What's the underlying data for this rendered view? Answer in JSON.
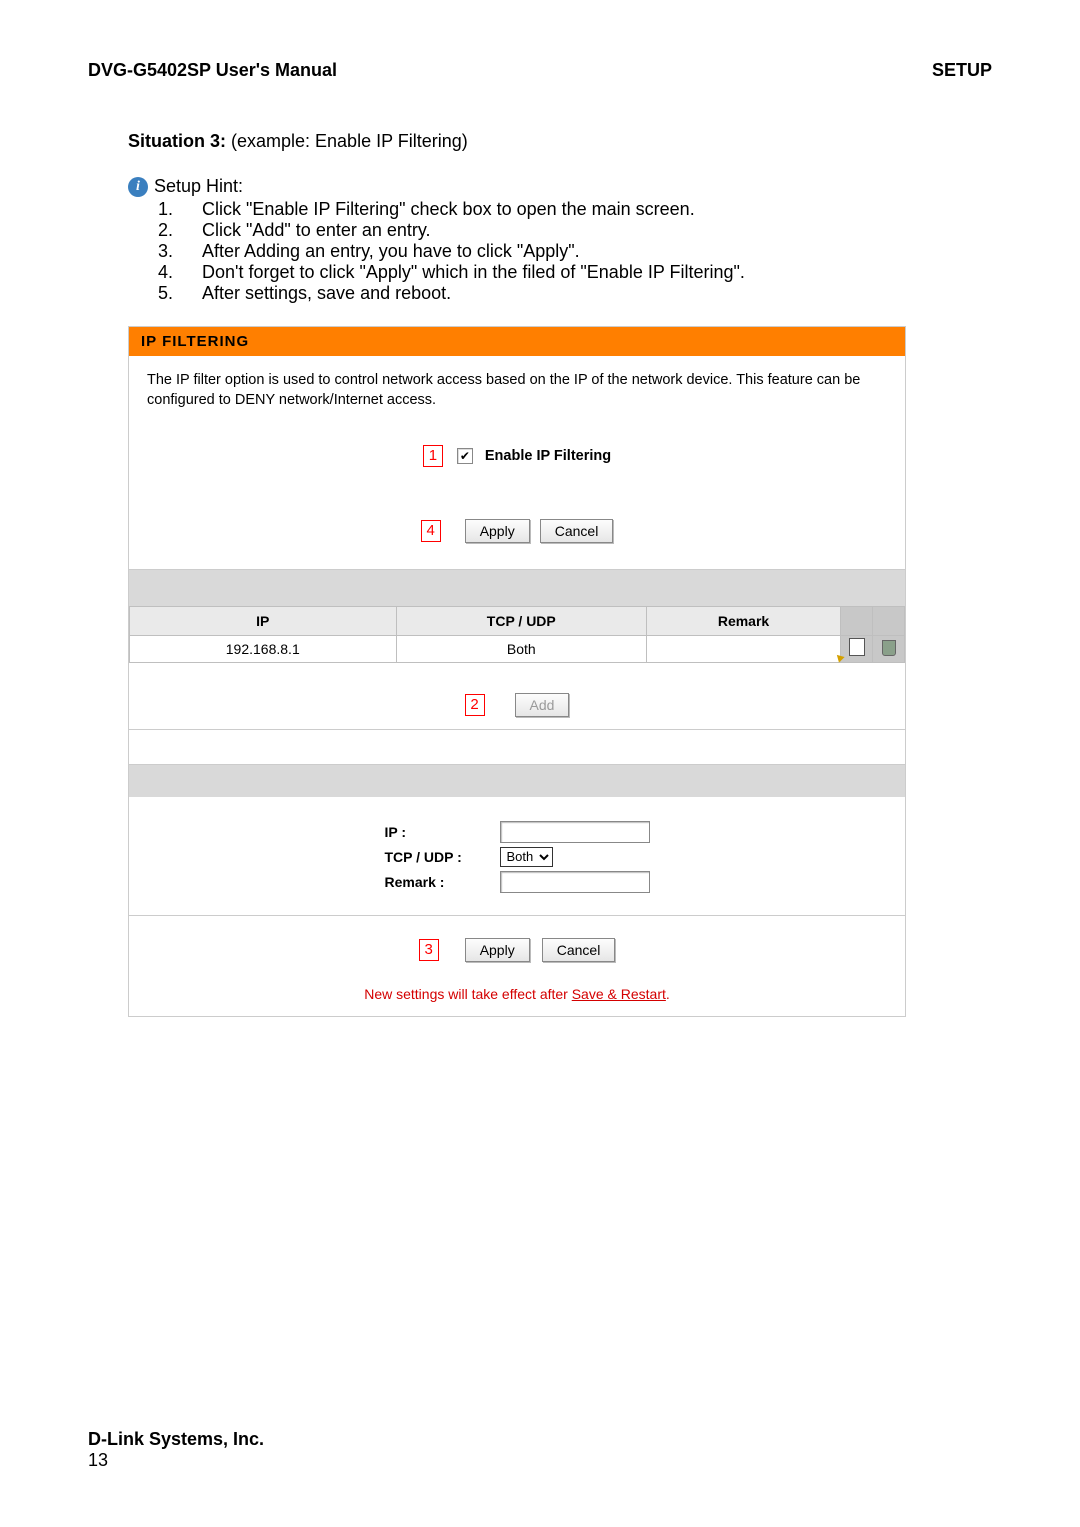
{
  "header": {
    "left": "DVG-G5402SP User's Manual",
    "right": "SETUP"
  },
  "situation": {
    "prefix": "Situation 3:",
    "text": " (example: Enable IP Filtering)"
  },
  "hint": {
    "title": "Setup Hint:",
    "items": [
      "Click \"Enable IP Filtering\" check box to open the main screen.",
      "Click \"Add\" to enter an entry.",
      "After Adding an entry, you have to click \"Apply\".",
      "Don't forget to click \"Apply\" which in the filed of \"Enable IP Filtering\".",
      "After settings, save and reboot."
    ]
  },
  "panel": {
    "title": "IP FILTERING",
    "desc": "The IP filter option is used to control network access based on the IP of the network device. This feature can be configured to DENY network/Internet access."
  },
  "callouts": {
    "c1": "1",
    "c2": "2",
    "c3": "3",
    "c4": "4"
  },
  "enable": {
    "label": "Enable IP Filtering",
    "checked": true
  },
  "buttons": {
    "apply": "Apply",
    "cancel": "Cancel",
    "add": "Add"
  },
  "table": {
    "headers": {
      "ip": "IP",
      "proto": "TCP / UDP",
      "remark": "Remark"
    },
    "rows": [
      {
        "ip": "192.168.8.1",
        "proto": "Both",
        "remark": ""
      }
    ]
  },
  "form": {
    "ip_label": "IP :",
    "ip_value": "",
    "proto_label": "TCP / UDP :",
    "proto_value": "Both",
    "remark_label": "Remark :",
    "remark_value": ""
  },
  "notice": {
    "prefix": "New settings will take effect after ",
    "link": "Save & Restart",
    "suffix": "."
  },
  "footer": {
    "company": "D-Link Systems, Inc.",
    "page": "13"
  }
}
